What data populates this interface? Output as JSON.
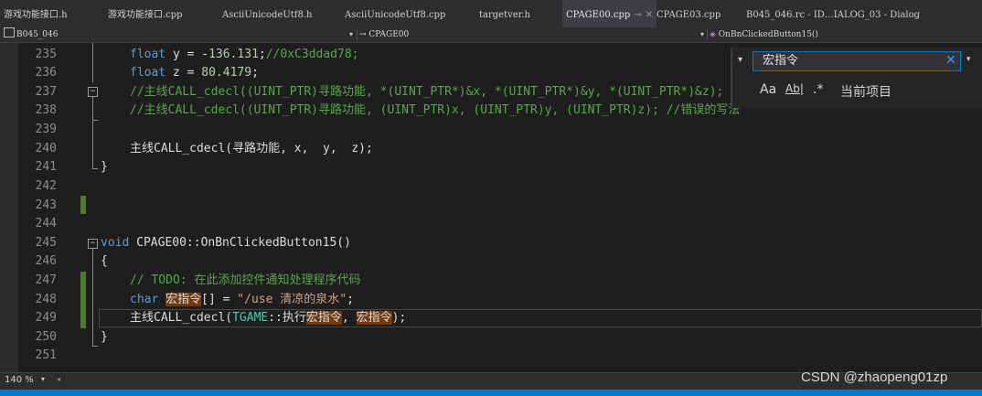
{
  "tabs": [
    {
      "label": "游戏功能接口.h"
    },
    {
      "label": "游戏功能接口.cpp"
    },
    {
      "label": "AsciiUnicodeUtf8.h"
    },
    {
      "label": "AsciiUnicodeUtf8.cpp"
    },
    {
      "label": "targetver.h"
    },
    {
      "label": "CPAGE00.cpp",
      "active": true
    },
    {
      "label": "CPAGE03.cpp"
    },
    {
      "label": "B045_046.rc - ID…IALOG_03 - Dialog"
    }
  ],
  "nav": {
    "project": "B045_046",
    "scope": "CPAGE00",
    "member": "OnBnClickedButton15()"
  },
  "line_numbers": [
    "235",
    "236",
    "237",
    "238",
    "239",
    "240",
    "241",
    "242",
    "243",
    "244",
    "245",
    "246",
    "247",
    "248",
    "249",
    "250",
    "251"
  ],
  "code": {
    "l235_a": "float",
    "l235_b": " y = -",
    "l235_n": "136.131",
    "l235_c": ";",
    "l235_cm": "//0xC3ddad78;",
    "l236_a": "float",
    "l236_b": " z = ",
    "l236_n": "80.4179",
    "l236_c": ";",
    "l237": "//主线CALL_cdecl((UINT_PTR)寻路功能, *(UINT_PTR*)&x, *(UINT_PTR*)&y, *(UINT_PTR*)&z);",
    "l238": "//主线CALL_cdecl((UINT_PTR)寻路功能, (UINT_PTR)x, (UINT_PTR)y, (UINT_PTR)z); //错误的写法",
    "l240": "主线CALL_cdecl(寻路功能, x,  y,  z);",
    "l241": "}",
    "l245_kw": "void",
    "l245_rest": " CPAGE00::OnBnClickedButton15()",
    "l246": "{",
    "l247": "// TODO: 在此添加控件通知处理程序代码",
    "l248_kw": "char",
    "l248_hl": "宏指令",
    "l248_mid": "[] = ",
    "l248_str": "\"/use 清凉的泉水\"",
    "l248_end": ";",
    "l249_a": "主线CALL_cdecl(",
    "l249_cls": "TGAME",
    "l249_b": "::执行",
    "l249_hl1": "宏指令",
    "l249_c": ", ",
    "l249_hl2": "宏指令",
    "l249_d": ");",
    "l250": "}"
  },
  "find": {
    "query": "宏指令",
    "opt_case": "Aa",
    "opt_word": "Ab|",
    "opt_regex": ".*",
    "scope": "当前项目"
  },
  "status": {
    "zoom": "140 %"
  },
  "watermark": "CSDN @zhaopeng01zp",
  "colors": {
    "keyword": "#569cd6",
    "comment": "#57a64a",
    "string": "#d69d85",
    "number": "#b5cea8",
    "type": "#4ec9b0",
    "highlight": "#6e3a12",
    "accent": "#007acc"
  }
}
